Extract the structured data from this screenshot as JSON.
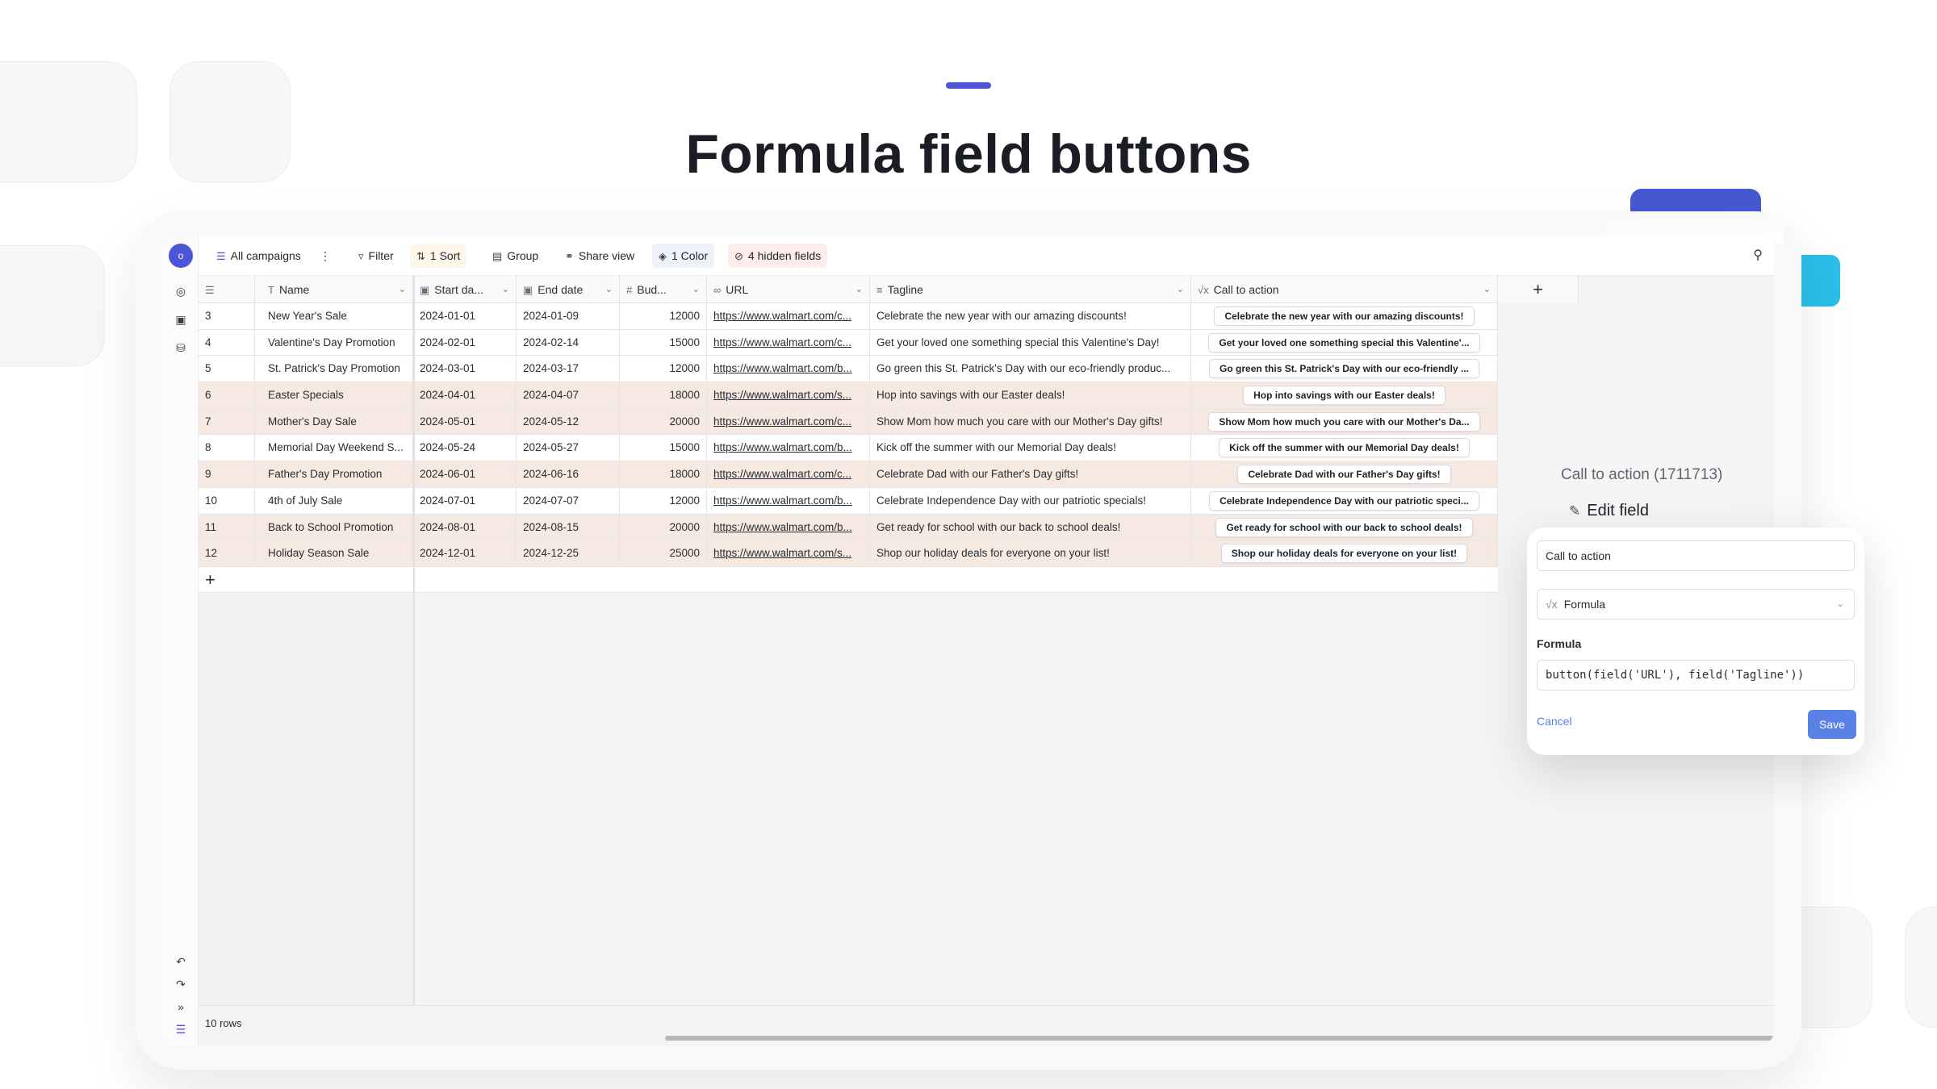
{
  "page": {
    "title": "Formula field buttons"
  },
  "sidebar": {
    "avatar_initial": "o"
  },
  "toolbar": {
    "view_name": "All campaigns",
    "filter_label": "Filter",
    "sort_label": "1 Sort",
    "group_label": "Group",
    "share_label": "Share view",
    "color_label": "1 Color",
    "hidden_fields_label": "4 hidden fields"
  },
  "table": {
    "columns": [
      "Name",
      "Start da...",
      "End date",
      "Bud...",
      "URL",
      "Tagline",
      "Call to action"
    ],
    "rows": [
      {
        "id": "3",
        "name": "New Year's Sale",
        "start": "2024-01-01",
        "end": "2024-01-09",
        "budget": "12000",
        "url": "https://www.walmart.com/c...",
        "tagline": "Celebrate the new year with our amazing discounts!",
        "cta": "Celebrate the new year with our amazing discounts!",
        "highlight": false
      },
      {
        "id": "4",
        "name": "Valentine's Day Promotion",
        "start": "2024-02-01",
        "end": "2024-02-14",
        "budget": "15000",
        "url": "https://www.walmart.com/c...",
        "tagline": "Get your loved one something special this Valentine's Day!",
        "cta": "Get your loved one something special this Valentine'...",
        "highlight": false
      },
      {
        "id": "5",
        "name": "St. Patrick's Day Promotion",
        "start": "2024-03-01",
        "end": "2024-03-17",
        "budget": "12000",
        "url": "https://www.walmart.com/b...",
        "tagline": "Go green this St. Patrick's Day with our eco-friendly produc...",
        "cta": "Go green this St. Patrick's Day with our eco-friendly ...",
        "highlight": false
      },
      {
        "id": "6",
        "name": "Easter Specials",
        "start": "2024-04-01",
        "end": "2024-04-07",
        "budget": "18000",
        "url": "https://www.walmart.com/s...",
        "tagline": "Hop into savings with our Easter deals!",
        "cta": "Hop into savings with our Easter deals!",
        "highlight": true
      },
      {
        "id": "7",
        "name": "Mother's Day Sale",
        "start": "2024-05-01",
        "end": "2024-05-12",
        "budget": "20000",
        "url": "https://www.walmart.com/c...",
        "tagline": "Show Mom how much you care with our Mother's Day gifts!",
        "cta": "Show Mom how much you care with our Mother's Da...",
        "highlight": true
      },
      {
        "id": "8",
        "name": "Memorial Day Weekend S...",
        "start": "2024-05-24",
        "end": "2024-05-27",
        "budget": "15000",
        "url": "https://www.walmart.com/b...",
        "tagline": "Kick off the summer with our Memorial Day deals!",
        "cta": "Kick off the summer with our Memorial Day deals!",
        "highlight": false
      },
      {
        "id": "9",
        "name": "Father's Day Promotion",
        "start": "2024-06-01",
        "end": "2024-06-16",
        "budget": "18000",
        "url": "https://www.walmart.com/c...",
        "tagline": "Celebrate Dad with our Father's Day gifts!",
        "cta": "Celebrate Dad with our Father's Day gifts!",
        "highlight": true
      },
      {
        "id": "10",
        "name": "4th of July Sale",
        "start": "2024-07-01",
        "end": "2024-07-07",
        "budget": "12000",
        "url": "https://www.walmart.com/b...",
        "tagline": "Celebrate Independence Day with our patriotic specials!",
        "cta": "Celebrate Independence Day with our patriotic speci...",
        "highlight": false
      },
      {
        "id": "11",
        "name": "Back to School Promotion",
        "start": "2024-08-01",
        "end": "2024-08-15",
        "budget": "20000",
        "url": "https://www.walmart.com/b...",
        "tagline": "Get ready for school with our back to school deals!",
        "cta": "Get ready for school with our back to school deals!",
        "highlight": true
      },
      {
        "id": "12",
        "name": "Holiday Season Sale",
        "start": "2024-12-01",
        "end": "2024-12-25",
        "budget": "25000",
        "url": "https://www.walmart.com/s...",
        "tagline": "Shop our holiday deals for everyone on your list!",
        "cta": "Shop our holiday deals for everyone on your list!",
        "highlight": true
      }
    ],
    "row_count_label": "10 rows",
    "highlight_color": "#f6e9e1"
  },
  "field_panel": {
    "header": "Call to action (1711713)",
    "edit_label": "Edit field",
    "name_value": "Call to action",
    "type_value": "Formula",
    "formula_label": "Formula",
    "formula_value": "button(field('URL'), field('Tagline'))",
    "cancel_label": "Cancel",
    "save_label": "Save"
  },
  "colors": {
    "accent": "#4a55d8",
    "save_button": "#5a82e6",
    "cyan_accent": "#2bbfe9"
  }
}
